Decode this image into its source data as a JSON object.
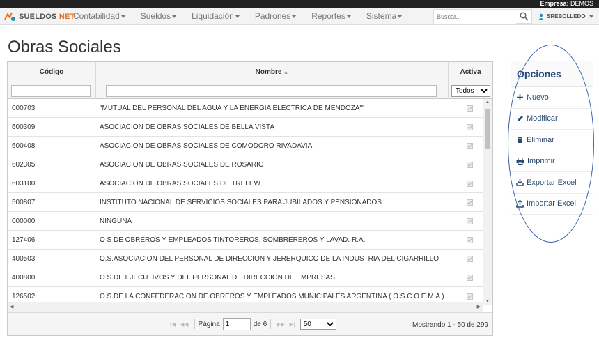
{
  "topbar": {
    "empresa_label": "Empresa:",
    "empresa_value": "DEMOS"
  },
  "brand": {
    "part1": "SUELDOS",
    "part2": "NET"
  },
  "nav": {
    "items": [
      {
        "label": "Contabilidad"
      },
      {
        "label": "Sueldos"
      },
      {
        "label": "Liquidación"
      },
      {
        "label": "Padrones"
      },
      {
        "label": "Reportes"
      },
      {
        "label": "Sistema"
      }
    ],
    "search_placeholder": "Buscar...",
    "user": "SREBOLLEDO"
  },
  "page": {
    "title": "Obras Sociales"
  },
  "grid": {
    "columns": {
      "codigo": "Código",
      "nombre": "Nombre",
      "activa": "Activa"
    },
    "activa_filter": "Todos",
    "rows": [
      {
        "codigo": "000703",
        "nombre": "\"MUTUAL DEL PERSONAL DEL AGUA Y LA ENERGIA ELECTRICA DE MENDOZA\"\"",
        "activa": true
      },
      {
        "codigo": "600309",
        "nombre": "ASOCIACION DE OBRAS SOCIALES DE BELLA VISTA",
        "activa": true
      },
      {
        "codigo": "600408",
        "nombre": "ASOCIACION DE OBRAS SOCIALES DE COMODORO RIVADAVIA",
        "activa": true
      },
      {
        "codigo": "602305",
        "nombre": "ASOCIACION DE OBRAS SOCIALES DE ROSARIO",
        "activa": true
      },
      {
        "codigo": "603100",
        "nombre": "ASOCIACION DE OBRAS SOCIALES DE TRELEW",
        "activa": true
      },
      {
        "codigo": "500807",
        "nombre": "INSTITUTO NACIONAL DE SERVICIOS SOCIALES PARA JUBILADOS Y PENSIONADOS",
        "activa": true
      },
      {
        "codigo": "000000",
        "nombre": "NINGUNA",
        "activa": true
      },
      {
        "codigo": "127406",
        "nombre": "O S  DE OBREROS Y EMPLEADOS TINTOREROS, SOMBREREROS Y LAVAD. R.A.",
        "activa": true
      },
      {
        "codigo": "400503",
        "nombre": "O.S.ASOCIACION DEL PERSONAL DE DIRECCION Y JERERQUICO DE LA INDUSTRIA DEL CIGARRILLO",
        "activa": true
      },
      {
        "codigo": "400800",
        "nombre": "O.S.DE EJECUTIVOS Y DEL PERSONAL DE DIRECCION DE EMPRESAS",
        "activa": true
      },
      {
        "codigo": "126502",
        "nombre": "O.S.DE LA CONFEDERACION DE OBREROS Y EMPLEADOS MUNICIPALES ARGENTINA ( O.S.C.O.E.M.A )",
        "activa": true
      }
    ],
    "pager": {
      "page_label": "Página",
      "page_value": "1",
      "of_label": "de 6",
      "page_size": "50"
    },
    "showing": "Mostrando 1 - 50 de 299"
  },
  "options": {
    "title": "Opciones",
    "items": [
      {
        "icon": "plus-icon",
        "label": "Nuevo"
      },
      {
        "icon": "pencil-icon",
        "label": "Modificar"
      },
      {
        "icon": "trash-icon",
        "label": "Eliminar"
      },
      {
        "icon": "printer-icon",
        "label": "Imprimir"
      },
      {
        "icon": "download-icon",
        "label": "Exportar Excel"
      },
      {
        "icon": "upload-icon",
        "label": "Importar Excel"
      }
    ]
  },
  "colors": {
    "brand_orange": "#e8731a",
    "options_blue": "#24487a",
    "annotation_oval": "#3a5fb0"
  }
}
